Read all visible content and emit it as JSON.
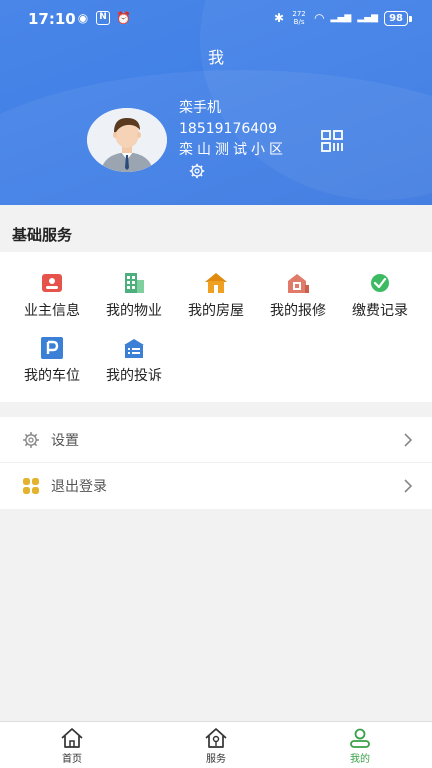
{
  "status_bar": {
    "time": "17:10",
    "network_speed": "272 B/s",
    "battery": "98"
  },
  "header": {
    "title": "我"
  },
  "profile": {
    "name": "栾手机",
    "phone": "18519176409",
    "community": "栾山测试小区"
  },
  "basic_services": {
    "title": "基础服务",
    "items": [
      {
        "label": "业主信息",
        "icon": "owner-card-icon",
        "color": "#e5534b"
      },
      {
        "label": "我的物业",
        "icon": "building-icon",
        "color": "#4caf7d"
      },
      {
        "label": "我的房屋",
        "icon": "house-icon",
        "color": "#f0a020"
      },
      {
        "label": "我的报修",
        "icon": "repair-icon",
        "color": "#e07b6a"
      },
      {
        "label": "缴费记录",
        "icon": "payment-check-icon",
        "color": "#3dbb62"
      },
      {
        "label": "我的车位",
        "icon": "parking-icon",
        "color": "#3b7fd6"
      },
      {
        "label": "我的投诉",
        "icon": "complaint-icon",
        "color": "#3b7fd6"
      }
    ]
  },
  "menu": [
    {
      "label": "设置",
      "icon": "gear-icon"
    },
    {
      "label": "退出登录",
      "icon": "logout-icon",
      "color": "#e3b22f"
    }
  ],
  "tabbar": [
    {
      "label": "首页",
      "icon": "home-icon",
      "active": false
    },
    {
      "label": "服务",
      "icon": "service-icon",
      "active": false
    },
    {
      "label": "我的",
      "icon": "user-icon",
      "active": true
    }
  ],
  "colors": {
    "header_blue": "#4a86e8",
    "active_tab": "#3aa14a"
  }
}
